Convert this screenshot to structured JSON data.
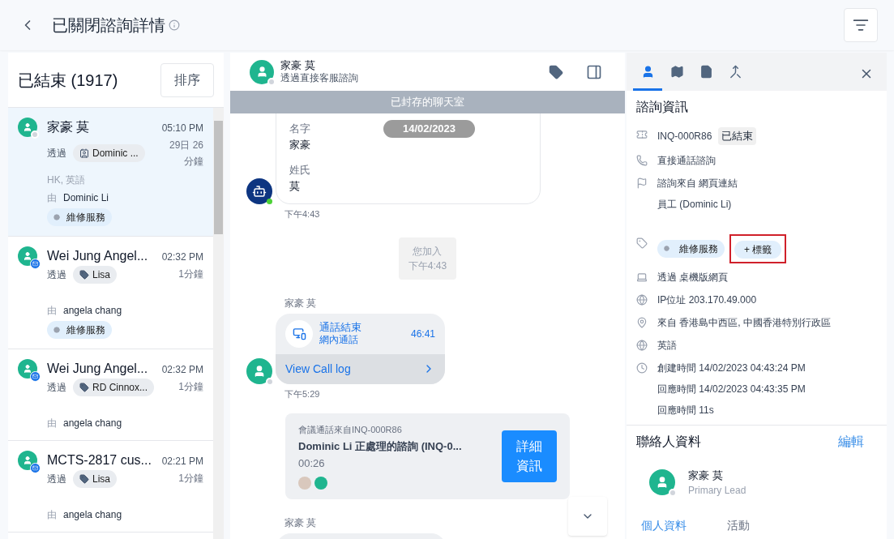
{
  "header": {
    "title": "已關閉諮詢詳情"
  },
  "list": {
    "title": "已結束 (1917)",
    "sort_button": "排序",
    "items": [
      {
        "name": "家豪 莫",
        "time": "05:10 PM",
        "duration": "29日 26分鐘",
        "via": "透過",
        "via_chip": {
          "kind": "contact",
          "label": "Dominic ..."
        },
        "extra": "HK, 英語",
        "by": "由",
        "agent": "Dominic Li",
        "tag": "維修服務",
        "channel": {
          "kind": "status"
        },
        "selected": true
      },
      {
        "name": "Wei Jung Angel...",
        "time": "02:32 PM",
        "duration": "1分鐘",
        "via": "透過",
        "via_chip": {
          "kind": "tag",
          "label": "Lisa"
        },
        "by": "由",
        "agent": "angela chang",
        "tag": "維修服務",
        "channel": {
          "kind": "mail"
        },
        "selected": false
      },
      {
        "name": "Wei Jung Angel...",
        "time": "02:32 PM",
        "duration": "1分鐘",
        "via": "透過",
        "via_chip": {
          "kind": "tag",
          "label": "RD Cinnox..."
        },
        "by": "由",
        "agent": "angela chang",
        "channel": {
          "kind": "mail"
        },
        "selected": false
      },
      {
        "name": "MCTS-2817 cus...",
        "time": "02:21 PM",
        "duration": "1分鐘",
        "via": "透過",
        "via_chip": {
          "kind": "tag",
          "label": "Lisa"
        },
        "by": "由",
        "agent": "angela chang",
        "channel": {
          "kind": "mail"
        },
        "selected": false
      }
    ]
  },
  "chat": {
    "name": "家豪 莫",
    "subtitle": "透過直接客服諮詢",
    "archived_banner": "已封存的聊天室",
    "date": "14/02/2023",
    "messages": [
      {
        "kind": "form",
        "fields": [
          {
            "label": "名字",
            "value": "家豪"
          },
          {
            "label": "姓氏",
            "value": "莫"
          }
        ],
        "time": "下午4:43"
      },
      {
        "kind": "system",
        "text": "您加入",
        "time": "下午4:43"
      },
      {
        "kind": "call",
        "sender": "家豪 莫",
        "title": "通話結束",
        "subtitle": "網內通話",
        "length": "46:41",
        "link": "View Call log",
        "time": "下午5:29"
      },
      {
        "kind": "conference",
        "caption": "會議通話來自INQ-000R86",
        "title": "Dominic Li 正處理的諮詢 (INQ-0...",
        "length": "00:26",
        "button": "詳細資訊"
      },
      {
        "kind": "partial",
        "sender": "家豪 莫"
      }
    ]
  },
  "details": {
    "tabs": [
      {
        "kind": "person",
        "selected": true
      },
      {
        "kind": "map",
        "selected": false
      },
      {
        "kind": "file",
        "selected": false
      },
      {
        "kind": "merge",
        "selected": false
      }
    ],
    "title": "諮詢資訊",
    "rows": [
      {
        "kind": "ticket",
        "lines": [
          "INQ-000R86"
        ],
        "status": "已結束"
      },
      {
        "kind": "phone",
        "lines": [
          "直接通話諮詢"
        ]
      },
      {
        "kind": "flag",
        "lines": [
          "諮詢來自 網頁連結",
          "員工 (Dominic Li)"
        ]
      },
      {
        "kind": "tags",
        "tags": [
          "維修服務"
        ],
        "add_tag": "+ 標籤",
        "highlighted": true
      },
      {
        "kind": "laptop",
        "lines": [
          "透過 桌機版網頁"
        ]
      },
      {
        "kind": "ip",
        "lines": [
          "IP位址 203.170.49.000"
        ]
      },
      {
        "kind": "pin",
        "lines": [
          "來自 香港島中西區, 中國香港特別行政區"
        ]
      },
      {
        "kind": "globe",
        "lines": [
          "英語"
        ]
      },
      {
        "kind": "clock",
        "lines": [
          "創建時間 14/02/2023 04:43:24 PM",
          "回應時間 14/02/2023 04:43:35 PM",
          "回應時間 11s"
        ]
      }
    ],
    "contact": {
      "title": "聯絡人資料",
      "edit": "編輯",
      "name": "家豪 莫",
      "role": "Primary Lead",
      "tabs": [
        {
          "label": "個人資料",
          "selected": true
        },
        {
          "label": "活動",
          "selected": false
        }
      ]
    }
  }
}
